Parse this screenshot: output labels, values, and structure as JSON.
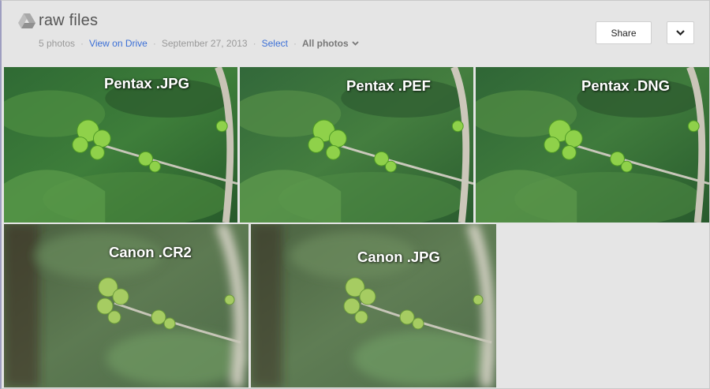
{
  "album": {
    "title": "raw files",
    "photo_count": "5 photos",
    "view_on_drive": "View on Drive",
    "date": "September 27, 2013",
    "select": "Select",
    "filter": "All photos"
  },
  "toolbar": {
    "share_label": "Share"
  },
  "icons": {
    "logo": "google-drive-icon",
    "filter_caret": "chevron-down-icon",
    "more": "chevron-down-icon"
  },
  "colors": {
    "link": "#3b6fd6",
    "background": "#e5e5e5",
    "leaf_green": "#8fd14a"
  },
  "photos": [
    {
      "caption": "Pentax .JPG"
    },
    {
      "caption": "Pentax .PEF"
    },
    {
      "caption": "Pentax .DNG"
    },
    {
      "caption": "Canon .CR2"
    },
    {
      "caption": "Canon .JPG"
    }
  ]
}
